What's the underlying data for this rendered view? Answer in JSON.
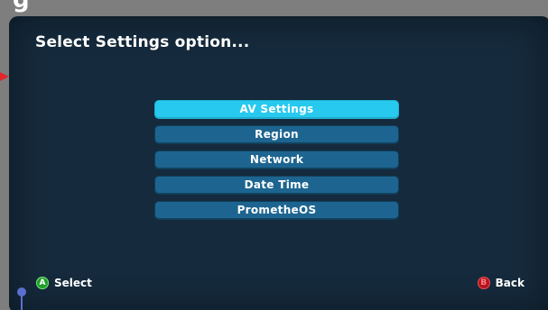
{
  "crop_title": "g",
  "screen": {
    "title": "Select Settings option..."
  },
  "menu": {
    "items": [
      {
        "label": "AV Settings",
        "selected": true
      },
      {
        "label": "Region",
        "selected": false
      },
      {
        "label": "Network",
        "selected": false
      },
      {
        "label": "Date Time",
        "selected": false
      },
      {
        "label": "PrometheOS",
        "selected": false
      }
    ]
  },
  "footer": {
    "select_glyph": "A",
    "select_label": "Select",
    "back_glyph": "B",
    "back_label": "Back"
  },
  "colors": {
    "screen_bg": "#152a3c",
    "item_bg": "#1d6590",
    "item_selected_bg": "#27c9ee",
    "a_button": "#1f9d2c",
    "b_button": "#b3151f",
    "marker": "#e0272b"
  },
  "icons": {
    "left_marker": "arrow-right-icon",
    "pin": "pin-icon",
    "a_button": "a-button-icon",
    "b_button": "b-button-icon"
  }
}
